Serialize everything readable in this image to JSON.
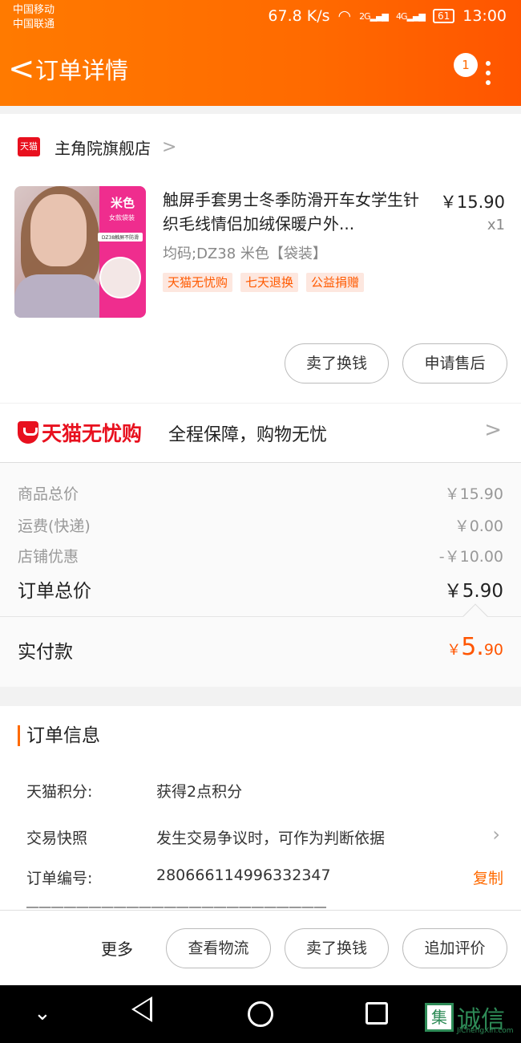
{
  "status_bar": {
    "carrier1": "中国移动",
    "carrier2": "中国联通",
    "speed": "67.8 K/s",
    "net1": "2G",
    "net2": "4G",
    "battery": "61",
    "time": "13:00"
  },
  "header": {
    "back_symbol": "<",
    "title": "订单详情",
    "badge": "1"
  },
  "shop": {
    "logo": "天猫",
    "name": "主角院旗舰店",
    "chevron": ">"
  },
  "product": {
    "image_title": "米色",
    "image_sub": "女款袋装",
    "image_label": "DZ38触屏不防滑",
    "title": "触屏手套男士冬季防滑开车女学生针织毛线情侣加绒保暖户外...",
    "price": "￥15.90",
    "quantity": "x1",
    "sku": "均码;DZ38 米色【袋装】",
    "tags": [
      "天猫无忧购",
      "七天退换",
      "公益捐赠"
    ]
  },
  "item_actions": {
    "sell": "卖了换钱",
    "after_sale": "申请售后"
  },
  "guarantee": {
    "brand": "天猫无忧购",
    "text": "全程保障，购物无忧",
    "chevron": ">"
  },
  "pricing": {
    "goods_label": "商品总价",
    "goods_value": "￥15.90",
    "shipping_label": "运费(快递)",
    "shipping_value": "￥0.00",
    "discount_label": "店铺优惠",
    "discount_value": "-￥10.00",
    "total_label": "订单总价",
    "total_value": "￥5.90"
  },
  "payment": {
    "label": "实付款",
    "currency": "￥",
    "integer": "5.",
    "decimal": "90"
  },
  "order_info": {
    "title": "订单信息",
    "points_label": "天猫积分:",
    "points_value": "获得2点积分",
    "snapshot_label": "交易快照",
    "snapshot_value": "发生交易争议时，可作为判断依据",
    "order_no_label": "订单编号:",
    "order_no_value": "280666114996332347",
    "copy": "复制"
  },
  "bottom_bar": {
    "more": "更多",
    "track": "查看物流",
    "sell": "卖了换钱",
    "review": "追加评价"
  },
  "watermark": {
    "mark": "集",
    "text": "诚信",
    "sub": "JiChengXin.com"
  },
  "colors": {
    "accent": "#ff6a00",
    "tmall_red": "#e8101e",
    "pay_orange": "#ff5500"
  }
}
